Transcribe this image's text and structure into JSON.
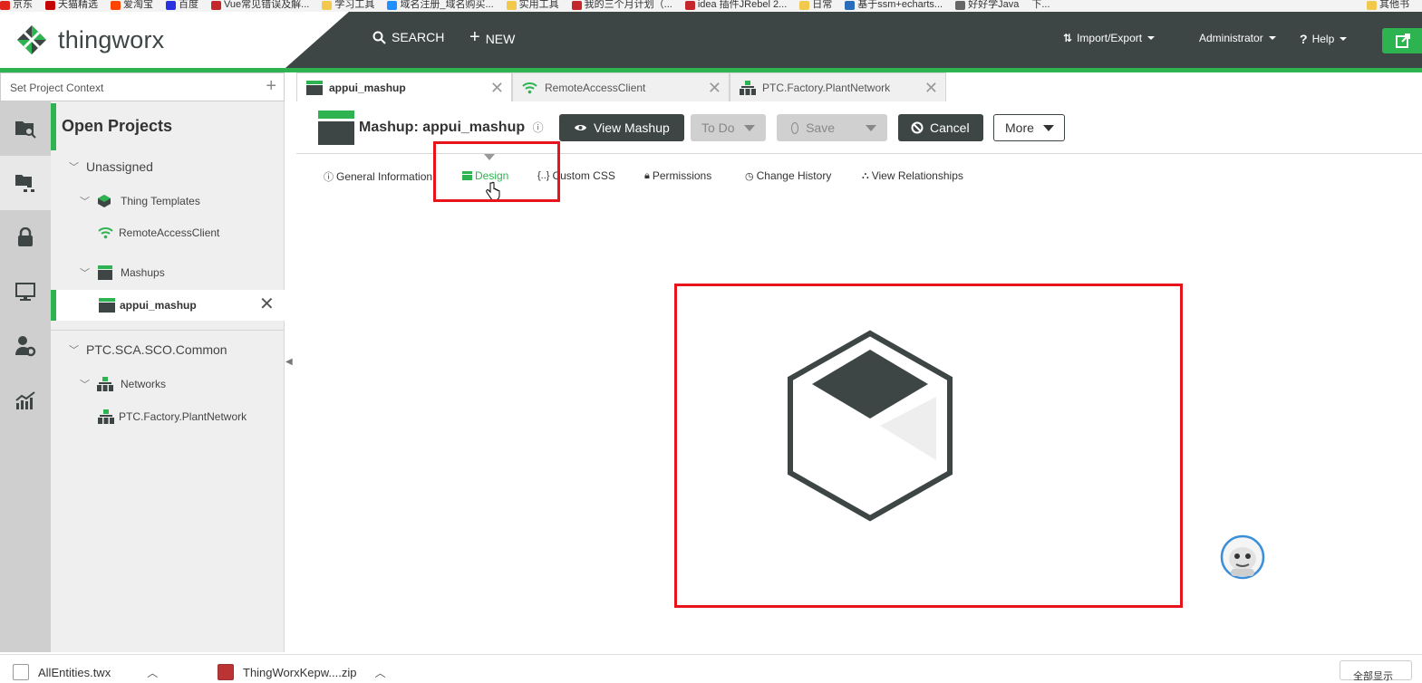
{
  "browser": {
    "bookmarks": [
      "京东",
      "天猫精选",
      "爱淘宝",
      "百度",
      "Vue常见错误及解...",
      "学习工具",
      "域名注册_域名购买...",
      "实用工具",
      "我的三个月计划（...",
      "idea 插件JRebel 2...",
      "日常",
      "基于ssm+echarts...",
      "好好学Java",
      "下...",
      "其他书"
    ],
    "downloads": [
      {
        "name": "AllEntities.twx"
      },
      {
        "name": "ThingWorxKepw....zip"
      }
    ],
    "show_all": "全部显示"
  },
  "header": {
    "logo_text": "thingworx",
    "search": "SEARCH",
    "new": "NEW",
    "import_export": "Import/Export",
    "user": "Administrator",
    "help": "Help",
    "colors": {
      "dark": "#3d4545",
      "green": "#2db451"
    }
  },
  "sidebar": {
    "rail_icons": [
      "folder-search-icon",
      "project-tree-icon",
      "lock-icon",
      "monitor-icon",
      "user-settings-icon",
      "analytics-chart-icon"
    ],
    "context_placeholder": "Set Project Context",
    "open_projects": "Open Projects",
    "tree": {
      "unassigned": "Unassigned",
      "thing_templates": "Thing Templates",
      "remote_access_client": "RemoteAccessClient",
      "mashups": "Mashups",
      "appui_mashup": "appui_mashup",
      "common": "PTC.SCA.SCO.Common",
      "networks": "Networks",
      "plant_network": "PTC.Factory.PlantNetwork"
    }
  },
  "tabs": [
    {
      "label": "appui_mashup"
    },
    {
      "label": "RemoteAccessClient"
    },
    {
      "label": "PTC.Factory.PlantNetwork"
    }
  ],
  "toolbar": {
    "title": "Mashup: appui_mashup",
    "view_mashup": "View Mashup",
    "todo": "To Do",
    "save": "Save",
    "cancel": "Cancel",
    "more": "More"
  },
  "subtabs": [
    {
      "label": "General Information"
    },
    {
      "label": "Design"
    },
    {
      "label": "Custom CSS"
    },
    {
      "label": "Permissions"
    },
    {
      "label": "Change History"
    },
    {
      "label": "View Relationships"
    }
  ]
}
